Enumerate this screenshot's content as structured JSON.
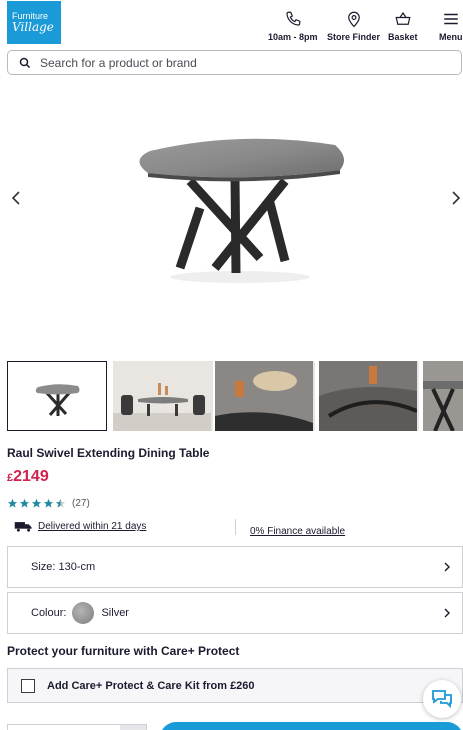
{
  "header": {
    "logo": {
      "line1": "Furniture",
      "line2": "Village"
    },
    "hours_label": "10am - 8pm",
    "store_finder_label": "Store Finder",
    "basket_label": "Basket",
    "menu_label": "Menu"
  },
  "search": {
    "placeholder": "Search for a product or brand"
  },
  "gallery": {
    "thumbnails": [
      "table-studio",
      "dining-room",
      "table-top-detail",
      "table-corner-detail",
      "table-base-detail"
    ],
    "active_index": 0
  },
  "product": {
    "title": "Raul Swivel Extending Dining Table",
    "price_currency": "£",
    "price_value": "2149",
    "rating": 4.5,
    "rating_count": "(27)",
    "delivery_label": "Delivered within 21 days",
    "finance_label": "0% Finance available"
  },
  "options": {
    "size_label": "Size: 130-cm",
    "colour_label": "Colour:",
    "colour_value": "Silver"
  },
  "protect": {
    "title": "Protect your furniture with Care+ Protect",
    "checkbox_label": "Add Care+ Protect & Care Kit from £260"
  },
  "colors": {
    "brand_blue": "#1a9ad6",
    "price_red": "#d1214f",
    "star_teal": "#1f8a9e"
  }
}
